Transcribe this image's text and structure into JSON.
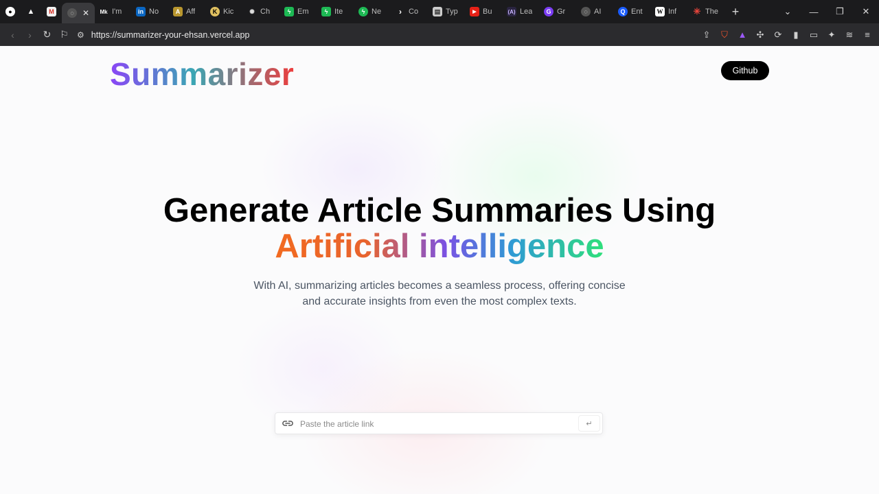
{
  "browser": {
    "tabs": [
      {
        "label": "",
        "favicon": "github-icon",
        "color": "#1b1b1d"
      },
      {
        "label": "",
        "favicon": "triangle-icon",
        "color": "#1b1b1d"
      },
      {
        "label": "",
        "favicon": "gmail-icon",
        "color": "#d93025"
      },
      {
        "label": "",
        "favicon": "globe-icon",
        "color": "#555",
        "active": true
      },
      {
        "label": "I'm",
        "favicon": "mk-icon",
        "color": "#1b1b1d"
      },
      {
        "label": "No",
        "favicon": "linkedin-icon",
        "color": "#0a66c2"
      },
      {
        "label": "Aff",
        "favicon": "affiliate-icon",
        "color": "#b8962e"
      },
      {
        "label": "Kic",
        "favicon": "k-icon",
        "color": "#1b1b1d"
      },
      {
        "label": "Ch",
        "favicon": "chatgpt-icon",
        "color": "#1b1b1d"
      },
      {
        "label": "Em",
        "favicon": "lightning-icon",
        "color": "#1db954"
      },
      {
        "label": "Ite",
        "favicon": "lightning-icon",
        "color": "#1db954"
      },
      {
        "label": "Ne",
        "favicon": "lightning-circle-icon",
        "color": "#1db954"
      },
      {
        "label": "Co",
        "favicon": "chevron-right-icon",
        "color": "#1b1b1d"
      },
      {
        "label": "Typ",
        "favicon": "typescript-icon",
        "color": "#888"
      },
      {
        "label": "Bu",
        "favicon": "youtube-icon",
        "color": "#e62117"
      },
      {
        "label": "Lea",
        "favicon": "codeacademy-icon",
        "color": "#5b3fd1"
      },
      {
        "label": "Gr",
        "favicon": "g-icon",
        "color": "#7a3cf2"
      },
      {
        "label": "AI",
        "favicon": "globe-icon",
        "color": "#555"
      },
      {
        "label": "Ent",
        "favicon": "q-icon",
        "color": "#1a5cff"
      },
      {
        "label": "Inf",
        "favicon": "wikipedia-icon",
        "color": "#fff"
      },
      {
        "label": "The",
        "favicon": "asterisk-icon",
        "color": "#e8453c"
      }
    ],
    "url": "https://summarizer-your-ehsan.vercel.app"
  },
  "page": {
    "logo": "Summarizer",
    "github_label": "Github",
    "headline_line1": "Generate Article Summaries Using",
    "headline_line2": "Artificial intelligence",
    "subtitle": "With AI, summarizing articles becomes a seamless process, offering concise and accurate insights from even the most complex texts.",
    "search_placeholder": "Paste the article link",
    "submit_icon": "enter-icon"
  }
}
